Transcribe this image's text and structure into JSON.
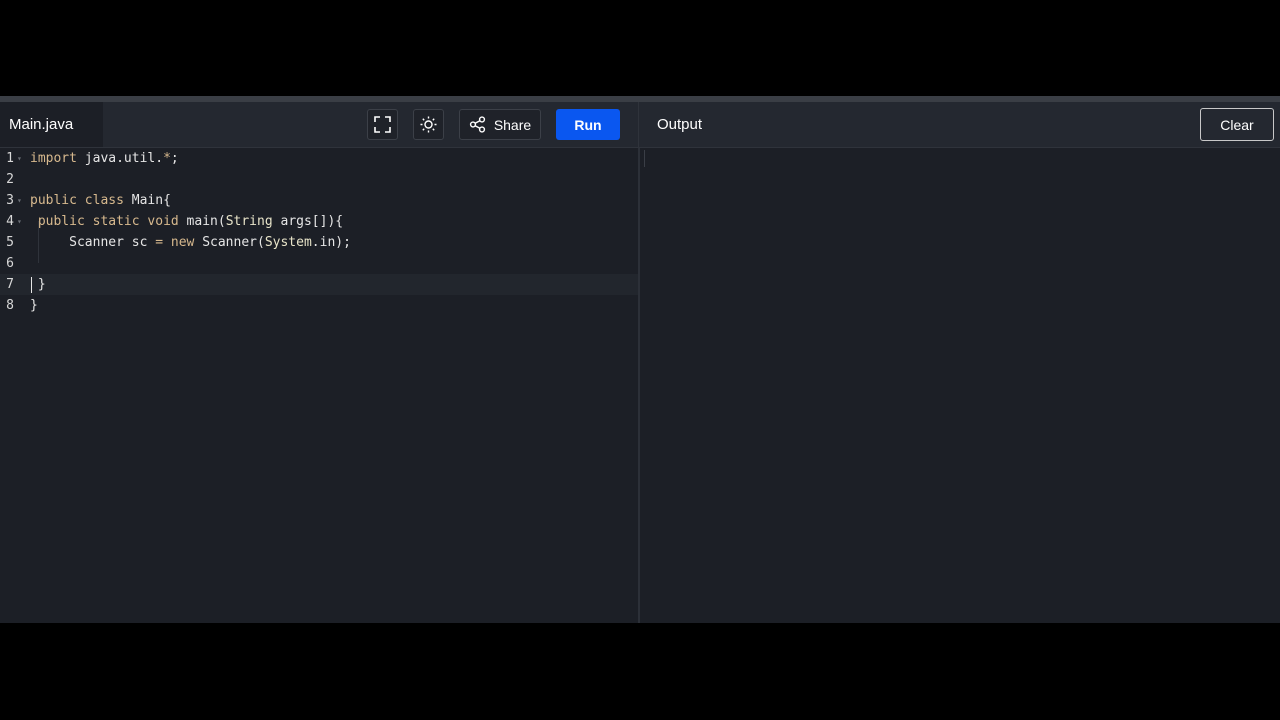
{
  "editor": {
    "file_name": "Main.java",
    "lines": [
      {
        "number": "1",
        "segments": [
          {
            "t": "import",
            "c": "kw"
          },
          {
            "t": " java.util.",
            "c": ""
          },
          {
            "t": "*",
            "c": "kw"
          },
          {
            "t": ";",
            "c": ""
          }
        ]
      },
      {
        "number": "2",
        "segments": []
      },
      {
        "number": "3",
        "segments": [
          {
            "t": "public",
            "c": "kw"
          },
          {
            "t": " ",
            "c": ""
          },
          {
            "t": "class",
            "c": "kw"
          },
          {
            "t": " Main{",
            "c": ""
          }
        ]
      },
      {
        "number": "4",
        "segments": [
          {
            "t": " ",
            "c": ""
          },
          {
            "t": "public",
            "c": "kw"
          },
          {
            "t": " ",
            "c": ""
          },
          {
            "t": "static",
            "c": "kw"
          },
          {
            "t": " ",
            "c": ""
          },
          {
            "t": "void",
            "c": "kw"
          },
          {
            "t": " main(",
            "c": ""
          },
          {
            "t": "String",
            "c": "type"
          },
          {
            "t": " args[]){",
            "c": ""
          }
        ]
      },
      {
        "number": "5",
        "segments": [
          {
            "t": "     Scanner sc ",
            "c": ""
          },
          {
            "t": "=",
            "c": "kw"
          },
          {
            "t": " ",
            "c": ""
          },
          {
            "t": "new",
            "c": "kw"
          },
          {
            "t": " Scanner(",
            "c": ""
          },
          {
            "t": "System",
            "c": "type"
          },
          {
            "t": ".in);",
            "c": ""
          }
        ]
      },
      {
        "number": "6",
        "segments": []
      },
      {
        "number": "7",
        "segments": [
          {
            "t": " }",
            "c": ""
          }
        ]
      },
      {
        "number": "8",
        "segments": [
          {
            "t": "}",
            "c": ""
          }
        ]
      }
    ],
    "fold_lines": [
      "1",
      "3",
      "4"
    ],
    "active_line": "7"
  },
  "toolbar": {
    "fullscreen_icon": "fullscreen-icon",
    "theme_icon": "sun-icon",
    "share_icon": "share-icon",
    "share_label": "Share",
    "run_label": "Run",
    "run_color": "#0a57f0"
  },
  "output": {
    "title": "Output",
    "clear_label": "Clear",
    "content": ""
  }
}
